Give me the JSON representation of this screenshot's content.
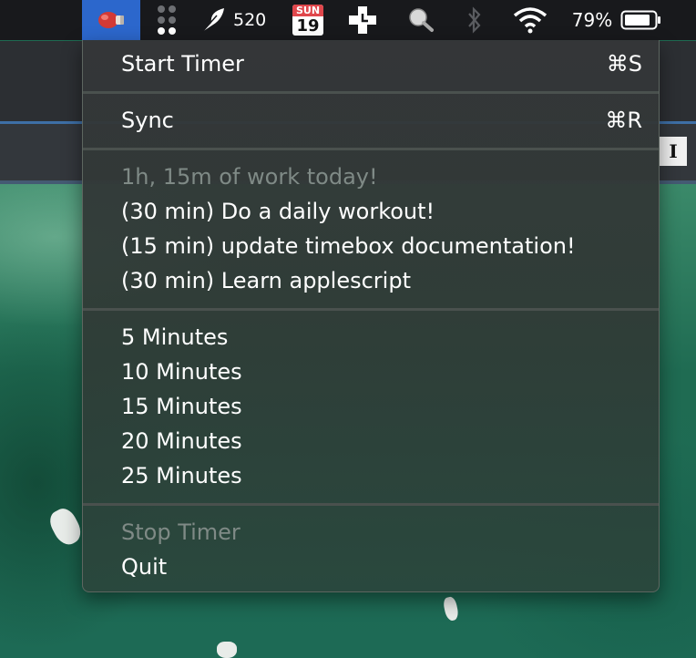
{
  "menubar": {
    "moving_count": "520",
    "calendar_day": "SUN",
    "calendar_date": "19",
    "battery_percent": "79%"
  },
  "menu": {
    "start_timer": "Start Timer",
    "start_timer_shortcut": "⌘S",
    "sync": "Sync",
    "sync_shortcut": "⌘R",
    "summary": "1h, 15m of work today!",
    "tasks": [
      "(30 min) Do a daily workout!",
      "(15 min) update timebox documentation!",
      "(30 min) Learn applescript"
    ],
    "durations": [
      "5 Minutes",
      "10 Minutes",
      "15 Minutes",
      "20 Minutes",
      "25 Minutes"
    ],
    "stop_timer": "Stop Timer",
    "quit": "Quit"
  },
  "background": {
    "cursor_glyph": "I"
  },
  "colors": {
    "menubar_bg": "#18191c",
    "active_item": "#2c67cc",
    "calendar_red": "#e0474c"
  },
  "icons": [
    "boxing-glove-icon",
    "dots-grid-icon",
    "feather-icon",
    "calendar-icon",
    "plus-clock-icon",
    "globe-magnifier-icon",
    "bluetooth-icon",
    "wifi-icon",
    "battery-icon"
  ]
}
